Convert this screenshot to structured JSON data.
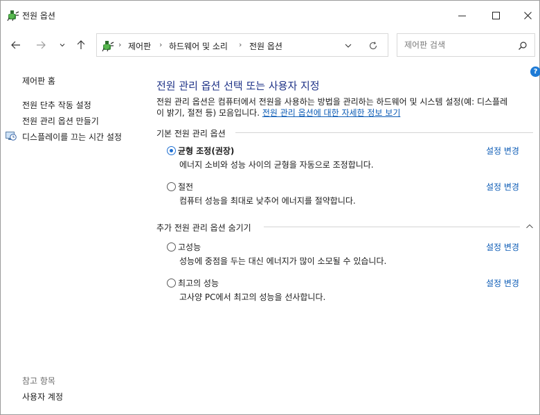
{
  "window": {
    "title": "전원 옵션"
  },
  "address_bar": {
    "crumbs": [
      "제어판",
      "하드웨어 및 소리",
      "전원 옵션"
    ],
    "separator": "›"
  },
  "search": {
    "placeholder": "제어판 검색"
  },
  "help_label": "?",
  "left_pane": {
    "home": "제어판 홈",
    "links": [
      "전원 단추 작동 설정",
      "전원 관리 옵션 만들기",
      "디스플레이를 끄는 시간 설정"
    ],
    "see_also_title": "참고 항목",
    "see_also_links": [
      "사용자 계정"
    ]
  },
  "main": {
    "title": "전원 관리 옵션 선택 또는 사용자 지정",
    "description_line1": "전원 관리 옵션은 컴퓨터에서 전원을 사용하는 방법을 관리하는 하드웨어 및 시스템 설정(예: 디스플레",
    "description_line2": "이 밝기, 절전 등) 모음입니다. ",
    "description_link": "전원 관리 옵션에 대한 자세한 정보 보기",
    "default_section": "기본 전원 관리 옵션",
    "hidden_section": "추가 전원 관리 옵션 숨기기",
    "change_label": "설정 변경",
    "plans": [
      {
        "name": "균형 조정(권장)",
        "description": "에너지 소비와 성능 사이의 균형을 자동으로 조정합니다.",
        "selected": true
      },
      {
        "name": "절전",
        "description": "컴퓨터 성능을 최대로 낮추어 에너지를 절약합니다.",
        "selected": false
      },
      {
        "name": "고성능",
        "description": "성능에 중점을 두는 대신 에너지가 많이 소모될 수 있습니다.",
        "selected": false
      },
      {
        "name": "최고의 성능",
        "description": "고사양 PC에서 최고의 성능을 선사합니다.",
        "selected": false
      }
    ]
  },
  "colors": {
    "title_blue": "#1e3287",
    "link_blue": "#0b5bb5",
    "radio_blue": "#1f6fd1",
    "help_blue": "#1e7bd6"
  }
}
